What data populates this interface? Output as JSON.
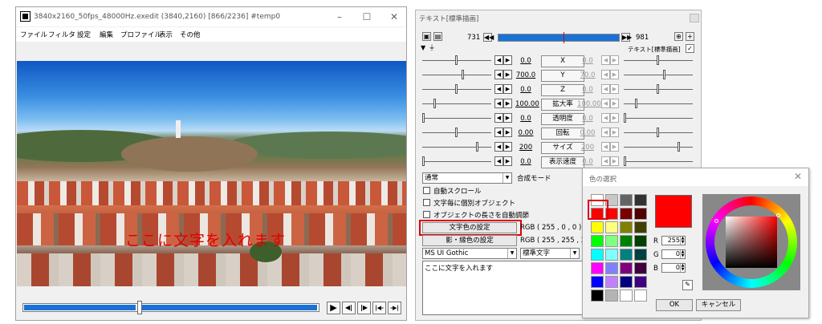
{
  "preview_window": {
    "title": "3840x2160_50fps_48000Hz.exedit (3840,2160)  [866/2236]  #temp0",
    "menu": [
      "ファイル",
      "フィルタ",
      "設定",
      "編集",
      "プロファイル",
      "表示",
      "その他"
    ],
    "video_caption": "ここに文字を入れます",
    "seek_position": 0.387,
    "playback_buttons": [
      "▶",
      "◀|",
      "|▶",
      "|◀-",
      "-▶|"
    ]
  },
  "object_window": {
    "title": "テキスト[標準描画]",
    "range_start": "731",
    "range_end": "981",
    "object_label": "テキスト[標準描画]",
    "params": [
      {
        "name": "X",
        "left": "0.0",
        "right": "0.0",
        "slider": 0.5
      },
      {
        "name": "Y",
        "left": "700.0",
        "right": "70.0",
        "slider": 0.6
      },
      {
        "name": "Z",
        "left": "0.0",
        "right": "0.0",
        "slider": 0.5
      },
      {
        "name": "拡大率",
        "left": "100.00",
        "right": "100.00",
        "slider": 0.17
      },
      {
        "name": "透明度",
        "left": "0.0",
        "right": "0.0",
        "slider": 0.0
      },
      {
        "name": "回転",
        "left": "0.00",
        "right": "0.00",
        "slider": 0.5
      },
      {
        "name": "サイズ",
        "left": "200",
        "right": "200",
        "slider": 0.82
      },
      {
        "name": "表示速度",
        "left": "0.0",
        "right": "0.0",
        "slider": 0.0
      }
    ],
    "blend_mode": "通常",
    "blend_label": "合成モード",
    "checkboxes": [
      "自動スクロール",
      "文字毎に個別オブジェクト",
      "オブジェクトの長さを自動調節"
    ],
    "text_color_button": "文字色の設定",
    "text_color_value": "RGB ( 255 , 0 , 0 )",
    "shadow_color_button": "影・縁色の設定",
    "shadow_color_value": "RGB ( 255 , 255 , 255",
    "font": "MS UI Gothic",
    "style": "標準文字",
    "text_content": "ここに文字を入れます"
  },
  "color_dialog": {
    "title": "色の選択",
    "swatches": [
      "#ffffff",
      "#c8c8c8",
      "#646464",
      "#323232",
      "#ff0000",
      "#ff0000",
      "#780000",
      "#500000",
      "#ffff00",
      "#ffff80",
      "#808000",
      "#404000",
      "#00ff00",
      "#80ff80",
      "#008000",
      "#004000",
      "#00ffff",
      "#80ffff",
      "#008080",
      "#004040",
      "#ff00ff",
      "#8080ff",
      "#800080",
      "#400040",
      "#0000ff",
      "#c080ff",
      "#000080",
      "#400080",
      "#000000",
      "#b4b4b4",
      "#ffffff",
      "#ffffff"
    ],
    "r_label": "R",
    "r_value": "255",
    "g_label": "G",
    "g_value": "0",
    "b_label": "B",
    "b_value": "0",
    "ok_label": "OK",
    "cancel_label": "キャンセル",
    "selected_color": "#ff0000"
  }
}
